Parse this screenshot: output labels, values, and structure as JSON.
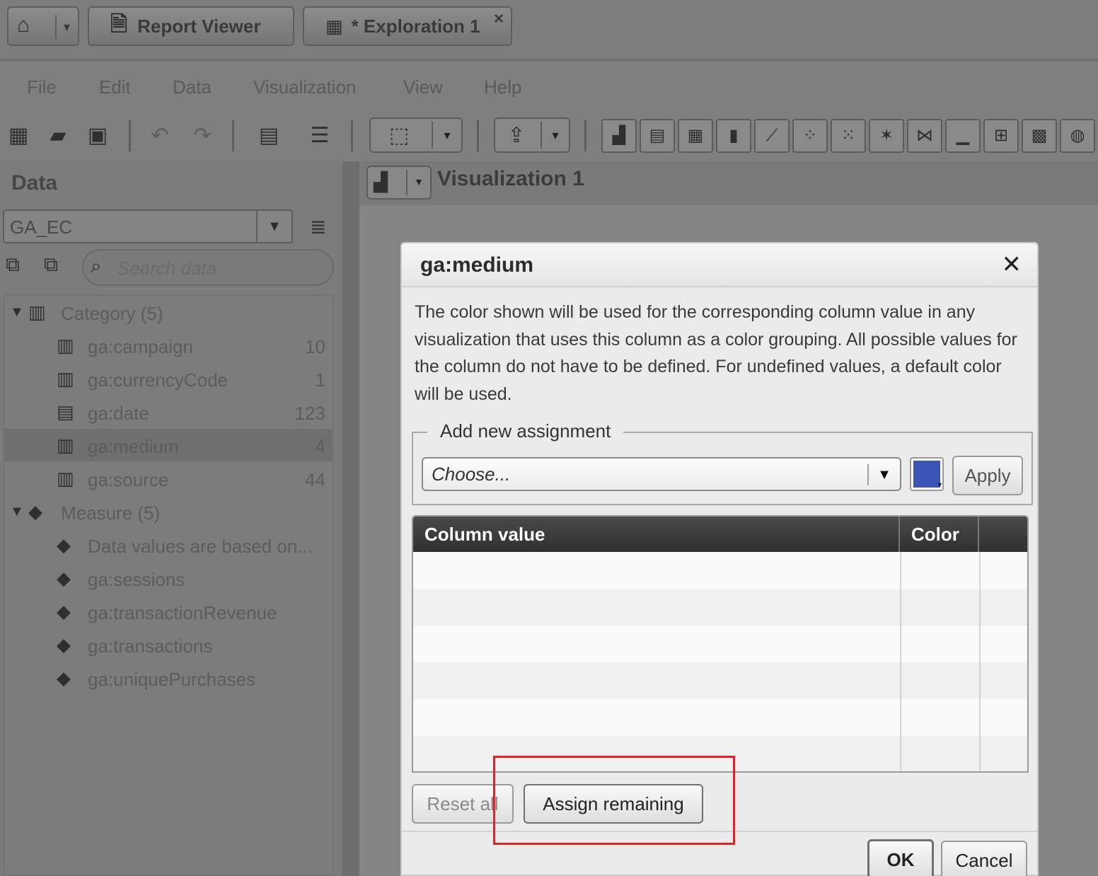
{
  "tabs": {
    "home_icon": "home-icon",
    "report_viewer": "Report Viewer",
    "exploration": "* Exploration 1",
    "close_glyph": "×"
  },
  "menu": [
    "File",
    "Edit",
    "Data",
    "Visualization",
    "View",
    "Help"
  ],
  "data_panel": {
    "title": "Data",
    "datasource": "GA_EC",
    "search_placeholder": "Search data",
    "category_label": "Category (5)",
    "measure_label": "Measure (5)",
    "categories": [
      {
        "label": "ga:campaign",
        "count": "10"
      },
      {
        "label": "ga:currencyCode",
        "count": "1"
      },
      {
        "label": "ga:date",
        "count": "123"
      },
      {
        "label": "ga:medium",
        "count": "4"
      },
      {
        "label": "ga:source",
        "count": "44"
      }
    ],
    "measures": [
      "Data values are based on...",
      "ga:sessions",
      "ga:transactionRevenue",
      "ga:transactions",
      "ga:uniquePurchases"
    ]
  },
  "visualization": {
    "title": "Visualization 1"
  },
  "dialog": {
    "title": "ga:medium",
    "close": "✕",
    "description": "The color shown will be used for the corresponding column value in any visualization that uses this column as a color grouping.  All possible values for the column do not have to be defined.  For undefined values, a default color will be used.",
    "add_legend": "Add new assignment",
    "choose_placeholder": "Choose...",
    "swatch_color": "#3a55b5",
    "apply": "Apply",
    "columns": [
      "Column value",
      "Color"
    ],
    "reset_all": "Reset all",
    "assign_remaining": "Assign remaining",
    "ok": "OK",
    "cancel": "Cancel"
  },
  "highlight_color": "#e32226"
}
